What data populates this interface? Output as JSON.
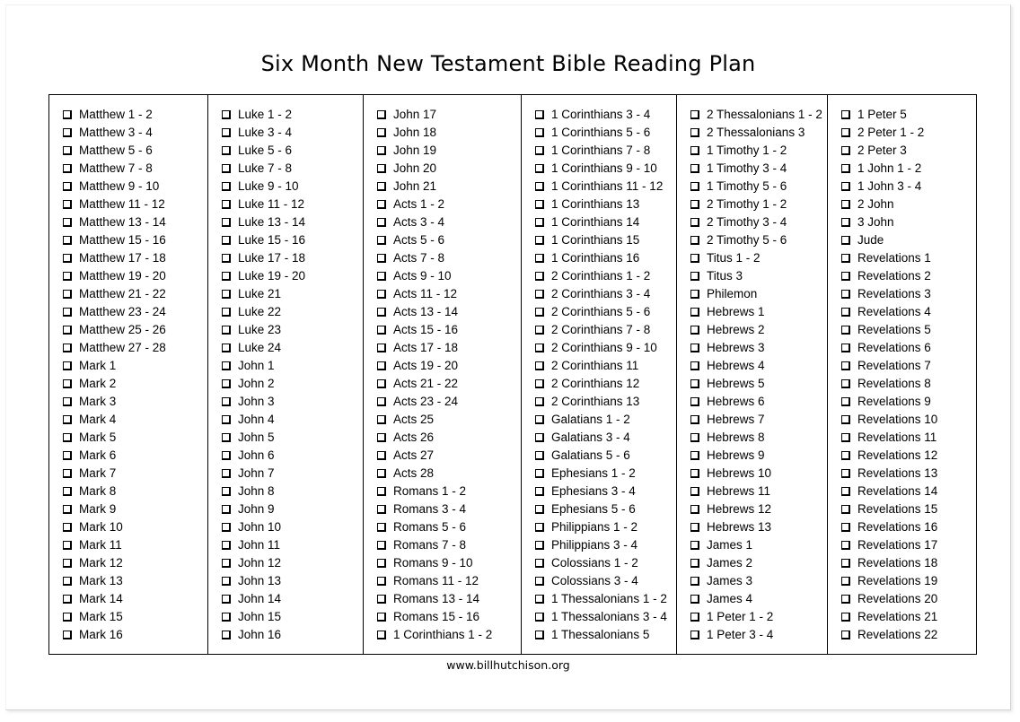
{
  "document": {
    "title": "Six Month New Testament Bible Reading Plan",
    "footer_url": "www.billhutchison.org",
    "checkbox_glyph": "empty-checkbox",
    "colors": {
      "text": "#000000",
      "page_background": "#ffffff",
      "table_border": "#000000",
      "page_border": "#d4d4d4"
    }
  },
  "columns": [
    {
      "index": 1,
      "entries": [
        "Matthew 1 - 2",
        "Matthew 3 - 4",
        "Matthew 5 - 6",
        "Matthew 7 - 8",
        "Matthew 9 - 10",
        "Matthew 11 - 12",
        "Matthew 13 - 14",
        "Matthew 15 - 16",
        "Matthew 17 - 18",
        "Matthew 19 - 20",
        "Matthew 21 - 22",
        "Matthew 23 - 24",
        "Matthew 25 - 26",
        "Matthew 27 - 28",
        "Mark 1",
        "Mark 2",
        "Mark 3",
        "Mark 4",
        "Mark 5",
        "Mark 6",
        "Mark 7",
        "Mark 8",
        "Mark 9",
        "Mark 10",
        "Mark 11",
        "Mark 12",
        "Mark 13",
        "Mark 14",
        "Mark 15",
        "Mark 16"
      ]
    },
    {
      "index": 2,
      "entries": [
        "Luke 1 - 2",
        "Luke 3 - 4",
        "Luke 5 - 6",
        "Luke 7 - 8",
        "Luke 9 - 10",
        "Luke 11 - 12",
        "Luke 13 - 14",
        "Luke 15 - 16",
        "Luke 17 - 18",
        "Luke 19 - 20",
        "Luke 21",
        "Luke 22",
        "Luke 23",
        "Luke 24",
        "John 1",
        "John 2",
        "John 3",
        "John 4",
        "John 5",
        "John 6",
        "John 7",
        "John 8",
        "John 9",
        "John 10",
        "John 11",
        "John 12",
        "John 13",
        "John 14",
        "John 15",
        "John 16"
      ]
    },
    {
      "index": 3,
      "entries": [
        "John 17",
        "John 18",
        "John 19",
        "John 20",
        "John 21",
        "Acts 1 - 2",
        "Acts 3 - 4",
        "Acts 5 - 6",
        "Acts 7 - 8",
        "Acts 9 - 10",
        "Acts 11 - 12",
        "Acts 13 - 14",
        "Acts 15 - 16",
        "Acts 17 - 18",
        "Acts 19 - 20",
        "Acts 21 - 22",
        "Acts 23 - 24",
        "Acts 25",
        "Acts 26",
        "Acts 27",
        "Acts 28",
        "Romans 1 - 2",
        "Romans 3 - 4",
        "Romans 5 - 6",
        "Romans 7 - 8",
        "Romans 9 - 10",
        "Romans 11 - 12",
        "Romans 13 - 14",
        "Romans 15 - 16",
        "1 Corinthians 1 - 2"
      ]
    },
    {
      "index": 4,
      "entries": [
        "1 Corinthians 3 - 4",
        "1 Corinthians 5 - 6",
        "1 Corinthians 7 - 8",
        "1 Corinthians 9 - 10",
        "1 Corinthians 11 - 12",
        "1 Corinthians 13",
        "1 Corinthians 14",
        "1 Corinthians 15",
        "1 Corinthians 16",
        "2 Corinthians 1 - 2",
        "2 Corinthians 3 - 4",
        "2 Corinthians 5 - 6",
        "2 Corinthians 7 - 8",
        "2 Corinthians 9 - 10",
        "2 Corinthians 11",
        "2 Corinthians 12",
        "2 Corinthians 13",
        "Galatians 1 - 2",
        "Galatians 3 - 4",
        "Galatians 5 - 6",
        "Ephesians 1 - 2",
        "Ephesians 3 - 4",
        "Ephesians 5 - 6",
        "Philippians 1 - 2",
        "Philippians 3 - 4",
        "Colossians 1 - 2",
        "Colossians 3 - 4",
        "1 Thessalonians 1 - 2",
        "1 Thessalonians 3 - 4",
        "1 Thessalonians 5"
      ]
    },
    {
      "index": 5,
      "entries": [
        "2 Thessalonians 1 - 2",
        "2 Thessalonians 3",
        "1 Timothy 1 - 2",
        "1 Timothy 3 - 4",
        "1 Timothy 5 - 6",
        "2 Timothy 1 - 2",
        "2 Timothy 3 - 4",
        "2 Timothy 5 - 6",
        "Titus 1 - 2",
        "Titus 3",
        "Philemon",
        "Hebrews 1",
        "Hebrews 2",
        "Hebrews 3",
        "Hebrews 4",
        "Hebrews 5",
        "Hebrews 6",
        "Hebrews 7",
        "Hebrews 8",
        "Hebrews 9",
        "Hebrews 10",
        "Hebrews 11",
        "Hebrews 12",
        "Hebrews 13",
        "James 1",
        "James 2",
        "James 3",
        "James 4",
        "1 Peter 1 - 2",
        "1 Peter 3 - 4"
      ]
    },
    {
      "index": 6,
      "entries": [
        "1 Peter 5",
        "2 Peter 1 - 2",
        "2 Peter 3",
        "1 John 1 - 2",
        "1 John 3 - 4",
        "2 John",
        "3 John",
        "Jude",
        "Revelations 1",
        "Revelations 2",
        "Revelations 3",
        "Revelations 4",
        "Revelations 5",
        "Revelations 6",
        "Revelations 7",
        "Revelations 8",
        "Revelations 9",
        "Revelations 10",
        "Revelations 11",
        "Revelations 12",
        "Revelations 13",
        "Revelations 14",
        "Revelations 15",
        "Revelations 16",
        "Revelations 17",
        "Revelations 18",
        "Revelations 19",
        "Revelations 20",
        "Revelations 21",
        "Revelations 22"
      ]
    }
  ]
}
